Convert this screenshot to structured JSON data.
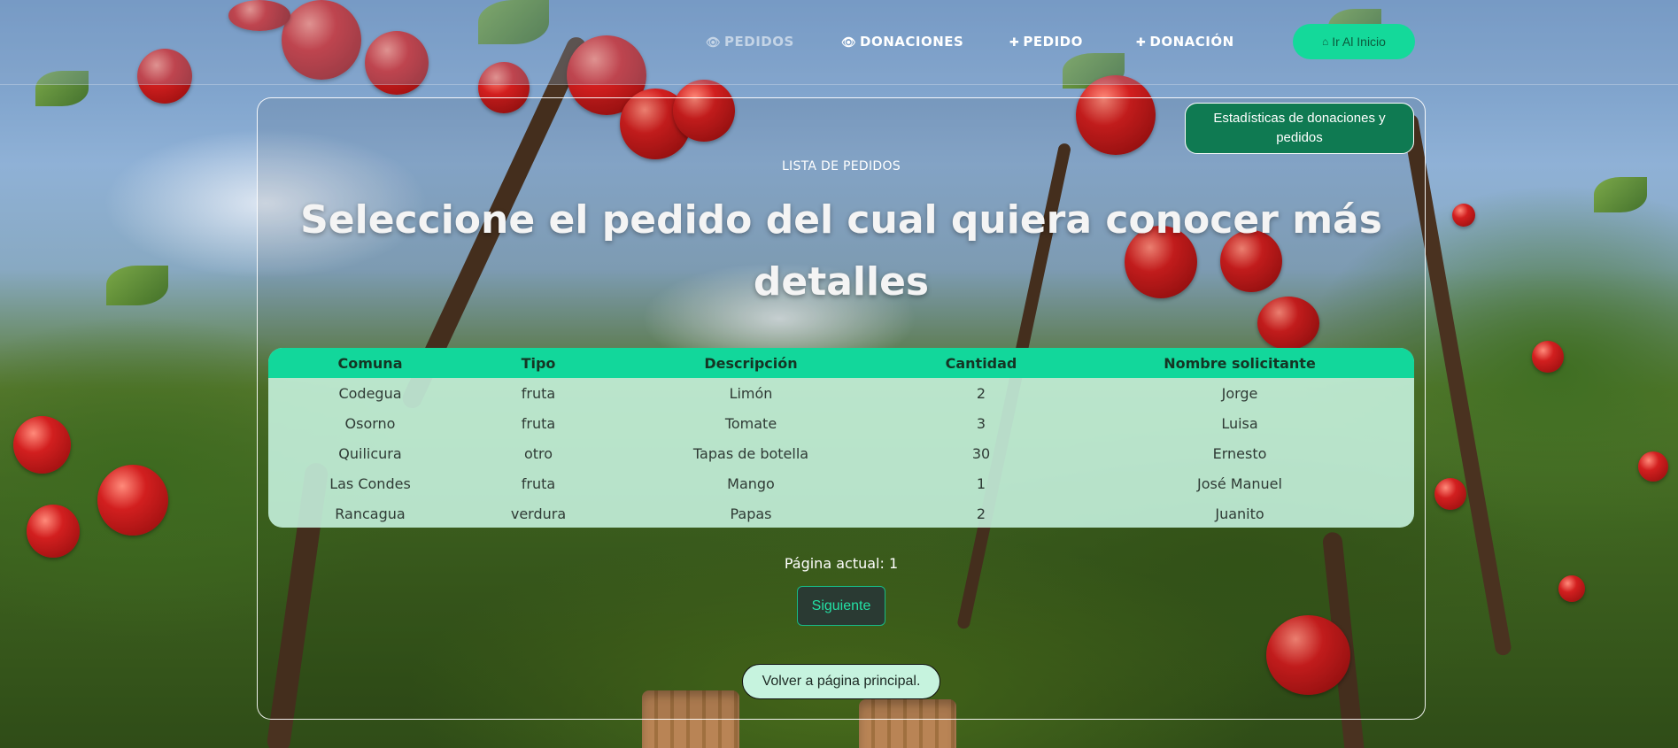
{
  "nav": {
    "items": [
      {
        "icon": "eye-icon",
        "glyph": "👁",
        "label": "PEDIDOS",
        "active": true
      },
      {
        "icon": "eye-icon",
        "glyph": "👁",
        "label": "DONACIONES"
      },
      {
        "icon": "plus-icon",
        "glyph": "✚",
        "label": "PEDIDO"
      },
      {
        "icon": "plus-icon",
        "glyph": "✚",
        "label": "DONACIÓN"
      }
    ],
    "home_button": {
      "icon": "home-icon",
      "glyph": "⌂",
      "label": "Ir Al Inicio"
    }
  },
  "stats_button": {
    "label": "Estadísticas de donaciones y pedidos"
  },
  "page": {
    "subtitle": "LISTA DE PEDIDOS",
    "heading": "Seleccione el pedido del cual quiera conocer más detalles"
  },
  "table": {
    "headers": [
      "Comuna",
      "Tipo",
      "Descripción",
      "Cantidad",
      "Nombre solicitante"
    ],
    "rows": [
      [
        "Codegua",
        "fruta",
        "Limón",
        "2",
        "Jorge"
      ],
      [
        "Osorno",
        "fruta",
        "Tomate",
        "3",
        "Luisa"
      ],
      [
        "Quilicura",
        "otro",
        "Tapas de botella",
        "30",
        "Ernesto"
      ],
      [
        "Las Condes",
        "fruta",
        "Mango",
        "1",
        "José Manuel"
      ],
      [
        "Rancagua",
        "verdura",
        "Papas",
        "2",
        "Juanito"
      ]
    ]
  },
  "pagination": {
    "current_page_label": "Página actual: 1",
    "next_label": "Siguiente"
  },
  "back_button": {
    "label": "Volver a página principal."
  },
  "colors": {
    "accent": "#14d99a",
    "stats_button": "#0f7a52",
    "table_body": "#c8f5e1"
  }
}
